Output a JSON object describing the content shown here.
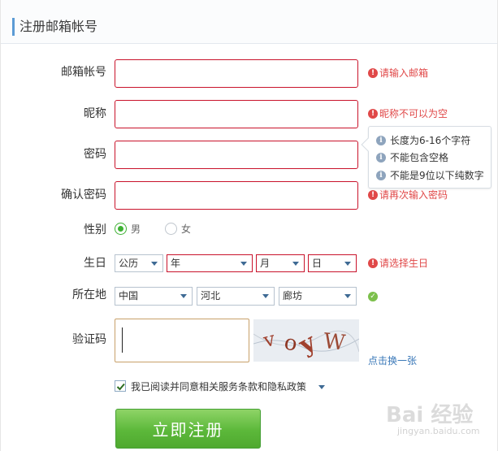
{
  "header": {
    "title": "注册邮箱帐号"
  },
  "fields": {
    "email": {
      "label": "邮箱帐号",
      "value": "",
      "error": "请输入邮箱"
    },
    "nickname": {
      "label": "昵称",
      "value": "",
      "error": "昵称不可以为空"
    },
    "password": {
      "label": "密码",
      "value": ""
    },
    "confirm": {
      "label": "确认密码",
      "value": "",
      "error": "请再次输入密码"
    }
  },
  "password_tips": [
    "长度为6-16个字符",
    "不能包含空格",
    "不能是9位以下纯数字"
  ],
  "gender": {
    "label": "性别",
    "options": [
      "男",
      "女"
    ],
    "selected": "男"
  },
  "birthday": {
    "label": "生日",
    "calendar": "公历",
    "year": "年",
    "month": "月",
    "day": "日",
    "error": "请选择生日"
  },
  "location": {
    "label": "所在地",
    "country": "中国",
    "province": "河北",
    "city": "廊坊"
  },
  "captcha": {
    "label": "验证码",
    "value": "",
    "refresh_link": "点击换一张",
    "image_text": "voyW"
  },
  "agreement": {
    "text": "我已阅读并同意相关服务条款和隐私政策",
    "checked": true
  },
  "submit_label": "立即注册",
  "watermark": {
    "brand": "Bai 经验",
    "url": "jingyan.baidu.com"
  },
  "colors": {
    "error": "#e04848",
    "accent_green": "#5cb83a",
    "link": "#3a78b8",
    "field_error_border": "#c9132b"
  }
}
